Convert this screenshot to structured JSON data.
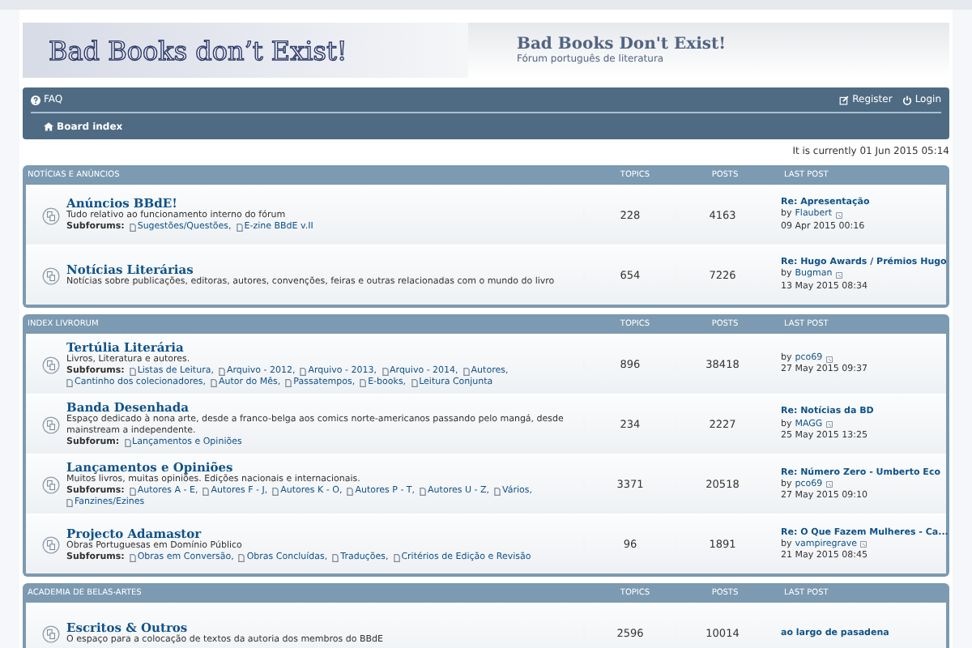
{
  "header": {
    "logo_text": "Bad Books don’t Exist!",
    "site_title": "Bad Books Don't Exist!",
    "site_description": "Fórum português de literatura"
  },
  "navbar": {
    "left_links": [
      "FAQ"
    ],
    "right_links": [
      "Register",
      "Login"
    ],
    "breadcrumb": "Board index"
  },
  "current_time": "It is currently 01 Jun 2015 05:14",
  "categories": [
    {
      "title": "NOTÍCIAS E ANÚNCIOS",
      "columns": [
        "TOPICS",
        "POSTS",
        "LAST POST"
      ],
      "forums": [
        {
          "name": "Anúncios BBdE!",
          "description": "Tudo relativo ao funcionamento interno do fórum",
          "subforums_label": "Subforums:",
          "subforums": [
            "Sugestões/Questões,",
            "E-zine BBdE v.II"
          ],
          "topics": "228",
          "posts": "4163",
          "last_post": {
            "title": "Re: Apresentação",
            "by": "by",
            "author": "Flaubert",
            "date": "09 Apr 2015 00:16"
          }
        },
        {
          "name": "Notícias Literárias",
          "description": "Notícias sobre publicações, editoras, autores, convenções, feiras e outras relacionadas com o mundo do livro",
          "topics": "654",
          "posts": "7226",
          "last_post": {
            "title": "Re: Hugo Awards / Prémios Hugo",
            "by": "by",
            "author": "Bugman",
            "date": "13 May 2015 08:34"
          }
        }
      ]
    },
    {
      "title": "INDEX LIVRORUM",
      "columns": [
        "TOPICS",
        "POSTS",
        "LAST POST"
      ],
      "forums": [
        {
          "name": "Tertúlia Literária",
          "description": "Livros, Literatura e autores.",
          "subforums_label": "Subforums:",
          "subforums": [
            "Listas de Leitura,",
            "Arquivo - 2012,",
            "Arquivo - 2013,",
            "Arquivo - 2014,",
            "Autores,",
            "Cantinho dos colecionadores,",
            "Autor do Mês,",
            "Passatempos,",
            "E-books,",
            "Leitura Conjunta"
          ],
          "topics": "896",
          "posts": "38418",
          "last_post": {
            "by": "by",
            "author": "pco69",
            "date": "27 May 2015 09:37"
          }
        },
        {
          "name": "Banda Desenhada",
          "description": "Espaço dedicado à nona arte, desde a franco-belga aos comics norte-americanos passando pelo mangá, desde mainstream a independente.",
          "subforums_label": "Subforum:",
          "subforums": [
            "Lançamentos e Opiniões"
          ],
          "topics": "234",
          "posts": "2227",
          "last_post": {
            "title": "Re: Notícias da BD",
            "by": "by",
            "author": "MAGG",
            "date": "25 May 2015 13:25"
          }
        },
        {
          "name": "Lançamentos e Opiniões",
          "description": "Muitos livros, muitas opiniões. Edições nacionais e internacionais.",
          "subforums_label": "Subforums:",
          "subforums": [
            "Autores A - E,",
            "Autores F - J,",
            "Autores K - O,",
            "Autores P - T,",
            "Autores U - Z,",
            "Vários,",
            "Fanzines/Ezines"
          ],
          "topics": "3371",
          "posts": "20518",
          "last_post": {
            "title": "Re: Número Zero - Umberto Eco",
            "by": "by",
            "author": "pco69",
            "date": "27 May 2015 09:10"
          }
        },
        {
          "name": "Projecto Adamastor",
          "description": "Obras Portuguesas em Domínio Público",
          "subforums_label": "Subforums:",
          "subforums": [
            "Obras em Conversão,",
            "Obras Concluídas,",
            "Traduções,",
            "Critérios de Edição e Revisão"
          ],
          "topics": "96",
          "posts": "1891",
          "last_post": {
            "title": "Re: O Que Fazem Mulheres - Ca...",
            "by": "by",
            "author": "vampiregrave",
            "date": "21 May 2015 08:45"
          }
        }
      ]
    },
    {
      "title": "ACADEMIA DE BELAS-ARTES",
      "columns": [
        "TOPICS",
        "POSTS",
        "LAST POST"
      ],
      "forums": [
        {
          "name": "Escritos & Outros",
          "description": "O espaço para a colocação de textos da autoria dos membros do BBdE",
          "topics": "2596",
          "posts": "10014",
          "last_post": {
            "title": "ao largo de pasadena"
          }
        }
      ]
    }
  ]
}
